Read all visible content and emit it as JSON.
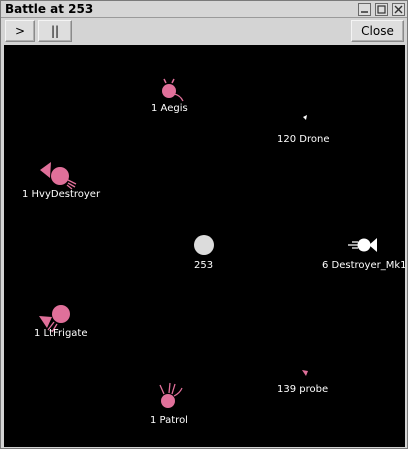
{
  "window": {
    "title": "Battle at 253",
    "wm_buttons": [
      "minimize-icon",
      "maximize-icon",
      "close-icon"
    ]
  },
  "toolbar": {
    "play_label": ">",
    "pause_label": "||",
    "close_label": "Close"
  },
  "colors": {
    "field_background": "#000000",
    "friendly_unit": "#e0709a",
    "enemy_unit": "#ffffff",
    "planet": "#dcdcdc"
  },
  "units": [
    {
      "label": "1 Aegis",
      "side": "friendly",
      "icon": "aegis-ship-icon"
    },
    {
      "label": "120 Drone",
      "side": "enemy",
      "icon": "drone-ship-icon"
    },
    {
      "label": "1 HvyDestroyer",
      "side": "friendly",
      "icon": "heavy-destroyer-ship-icon"
    },
    {
      "label": "253",
      "side": "neutral",
      "icon": "planet-icon"
    },
    {
      "label": "6 Destroyer_Mk1",
      "side": "enemy",
      "icon": "destroyer-ship-icon"
    },
    {
      "label": "1 LtFrigate",
      "side": "friendly",
      "icon": "light-frigate-ship-icon"
    },
    {
      "label": "139 probe",
      "side": "friendly",
      "icon": "probe-ship-icon"
    },
    {
      "label": "1 Patrol",
      "side": "friendly",
      "icon": "patrol-ship-icon"
    }
  ]
}
